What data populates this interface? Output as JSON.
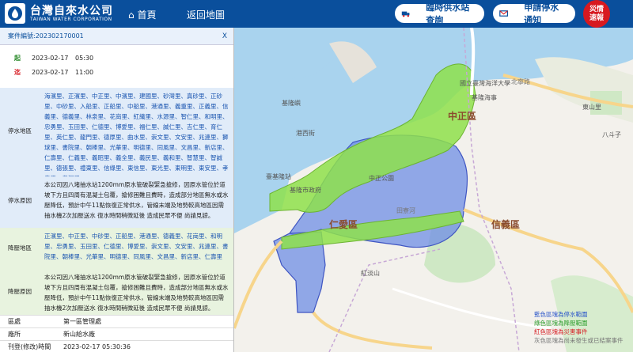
{
  "header": {
    "company_name": "台灣自來水公司",
    "company_name_en": "TAIWAN WATER CORPORATION",
    "home_label": "首頁",
    "back_label": "返回地圖",
    "supply_station_label": "臨時供水站查詢",
    "notify_label": "申請停水通知",
    "disaster_line1": "災情",
    "disaster_line2": "速報"
  },
  "panel": {
    "case_no": "案件編號:202302170001",
    "close": "X",
    "start_label": "起",
    "start_date": "2023-02-17",
    "start_time": "05:30",
    "end_label": "迄",
    "end_date": "2023-02-17",
    "end_time": "11:00",
    "outage_area_label": "停水地區",
    "outage_area": "海濱里、正濱里、中正里、中濱里、建國里、砂灣里、真砂里、正砂里、中砂里、入船里、正船里、中船里、港通里、義重里、正義里、信義里、德義里、林泉里、花崗里、紅織里、水源里、智仁里、和明里、忠勇里、玉田里、仁德里、博愛里、福仁里、誠仁里、吉仁里、育仁里、英仁里、龍門里、德厚里、曲水里、崇文里、文安里、兆連里、獅球里、書院里、朝棒里、光華里、明德里、同風里、文昌里、新店里、仁壽里、仁義里、義昭里、義全里、義民里、義和里、智慧里、智誠里、德張里、禮東里、信綠里、東信里、東光里、東明里、東安里、孝忠里、孝深里",
    "outage_reason_label": "停水原因",
    "outage_reason": "本公司因八堵抽水站1200mm原水管破裂緊急搶修，因原水管位於道坡下方且四周有混凝土包覆，搶修困難且費時，造成部分地區無水或水壓降低，預計中午11點恢復正常供水，管線末端及地勢較高地區因需抽水機2次加壓送水 復水時間稍微延後 造成民眾不便 尚請見諒。",
    "low_pressure_area_label": "降壓地區",
    "low_pressure_area": "正濱里、中正里、中砂里、正船里、港通里、德義里、花崗里、和明里、忠勇里、玉田里、仁德里、博愛里、崇文里、文安里、兆連里、書院里、朝棒里、光華里、明德里、同風里、文昌里、新店里、仁壽里",
    "low_pressure_reason_label": "降壓原因",
    "low_pressure_reason": "本公司因八堵抽水站1200mm原水管破裂緊急搶修，因原水管位於道坡下方且四周有混凝土包覆，搶修困難且費時，造成部分地區無水或水壓降低，預計中午11點恢復正常供水，管線末端及地勢較高地區因需抽水機2次加壓送水 復水時間稍微延後 造成民眾不便 尚請見諒。",
    "region_label": "區處",
    "region": "第一區管理處",
    "station_label": "廠所",
    "station": "新山給水廠",
    "published_label": "刊登(修改)時間",
    "published": "2023-02-17 05:30:36"
  },
  "map": {
    "districts": [
      "中正區",
      "仁愛區",
      "信義區"
    ],
    "places": [
      "國立臺灣海洋大學",
      "基隆海事",
      "港西街",
      "中正公園",
      "臺基隆站",
      "基隆市政府",
      "紅淡山",
      "東山里",
      "八斗子",
      "基隆嶼"
    ],
    "roads": [
      "北寧路",
      "田寮河"
    ],
    "legend": {
      "blue": "藍色區塊為停水範圍",
      "green": "綠色區塊為降壓範圍",
      "red": "紅色區塊為災害事件",
      "gray": "灰色區塊為尚未發生或已結案事件"
    },
    "colors": {
      "outage": "#6f8de6",
      "low_pressure": "#8ee04b",
      "disaster": "#e02020",
      "closed": "#999999",
      "header": "#0a4f9c"
    }
  }
}
